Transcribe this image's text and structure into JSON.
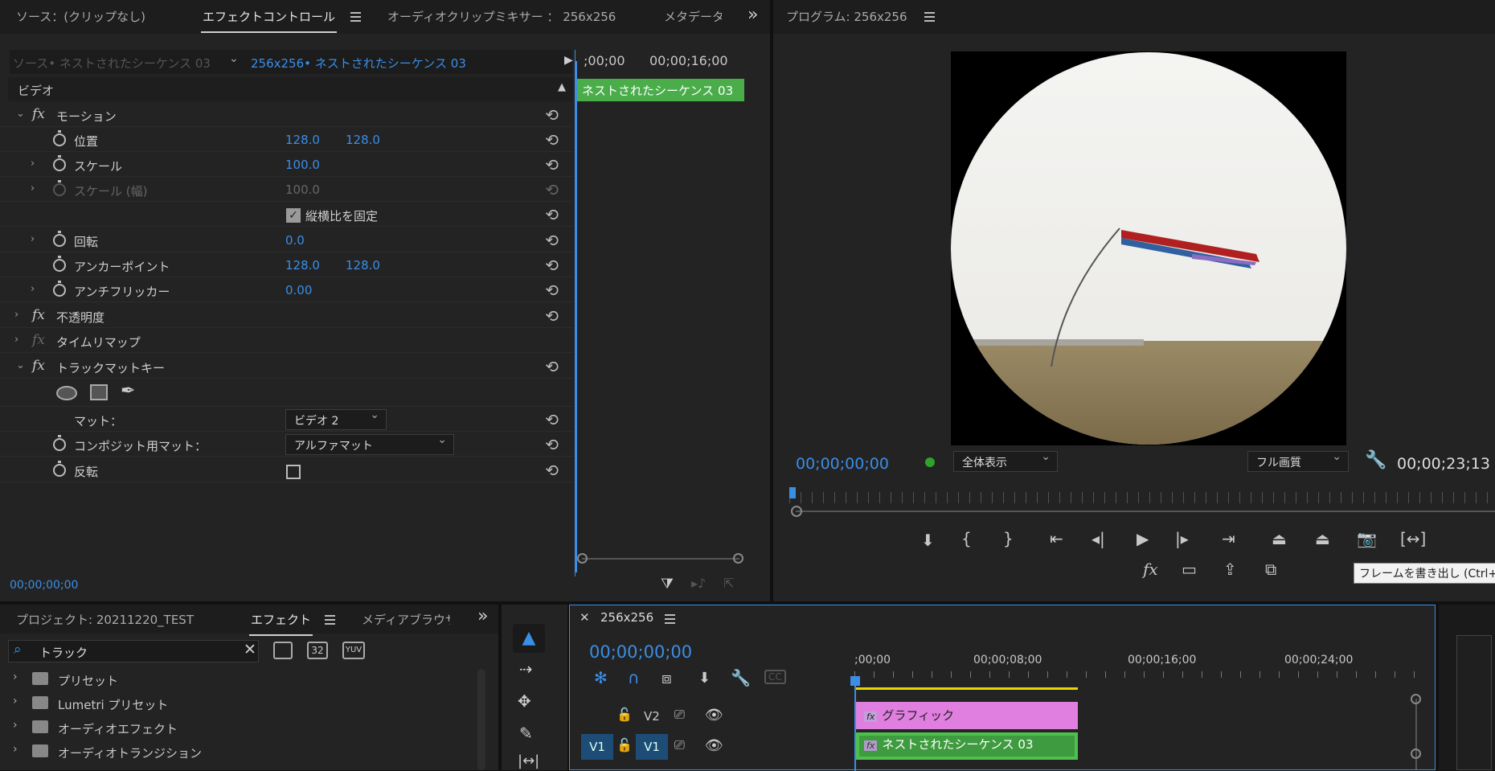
{
  "source_panel": {
    "tabs": [
      "ソース：(クリップなし)",
      "エフェクトコントロール",
      "オーディオクリップミキサー ： 256x256",
      "メタデータ"
    ],
    "source_seq": "ソース• ネストされたシーケンス 03",
    "active_seq": "256x256• ネストされたシーケンス 03",
    "mini_times": [
      ";00;00",
      "00;00;16;00"
    ],
    "clip_label": "ネストされたシーケンス 03",
    "section_video": "ビデオ",
    "footer_time": "00;00;00;00",
    "effects": [
      {
        "name": "モーション"
      },
      {
        "name": "位置",
        "v1": "128.0",
        "v2": "128.0"
      },
      {
        "name": "スケール",
        "v1": "100.0"
      },
      {
        "name": "スケール (幅)",
        "v1": "100.0"
      },
      {
        "name": "縦横比を固定"
      },
      {
        "name": "回転",
        "v1": "0.0"
      },
      {
        "name": "アンカーポイント",
        "v1": "128.0",
        "v2": "128.0"
      },
      {
        "name": "アンチフリッカー",
        "v1": "0.00"
      },
      {
        "name": "不透明度"
      },
      {
        "name": "タイムリマップ"
      },
      {
        "name": "トラックマットキー"
      },
      {
        "name": "マット："
      },
      {
        "name": "コンポジット用マット："
      },
      {
        "name": "反転"
      }
    ],
    "matte_value": "ビデオ 2",
    "composite_value": "アルファマット"
  },
  "program": {
    "title": "プログラム: 256x256",
    "timecode": "00;00;00;00",
    "zoom": "全体表示",
    "quality": "フル画質",
    "duration": "00;00;23;13",
    "tooltip": "フレームを書き出し (Ctrl+"
  },
  "project": {
    "tabs": [
      "プロジェクト: 20211220_TEST",
      "エフェクト",
      "メディアブラウザ"
    ],
    "search": "トラック",
    "items": [
      "プリセット",
      "Lumetri プリセット",
      "オーディオエフェクト",
      "オーディオトランジション"
    ],
    "icon_labels": [
      "32",
      "YUV"
    ]
  },
  "timeline": {
    "title": "256x256",
    "timecode": "00;00;00;00",
    "ruler": [
      ";00;00",
      "00;00;08;00",
      "00;00;16;00",
      "00;00;24;00"
    ],
    "tracks": [
      {
        "name": "V2"
      },
      {
        "name": "V1",
        "src": "V1"
      }
    ],
    "clips": [
      "グラフィック",
      "ネストされたシーケンス 03"
    ],
    "cc": "CC"
  }
}
